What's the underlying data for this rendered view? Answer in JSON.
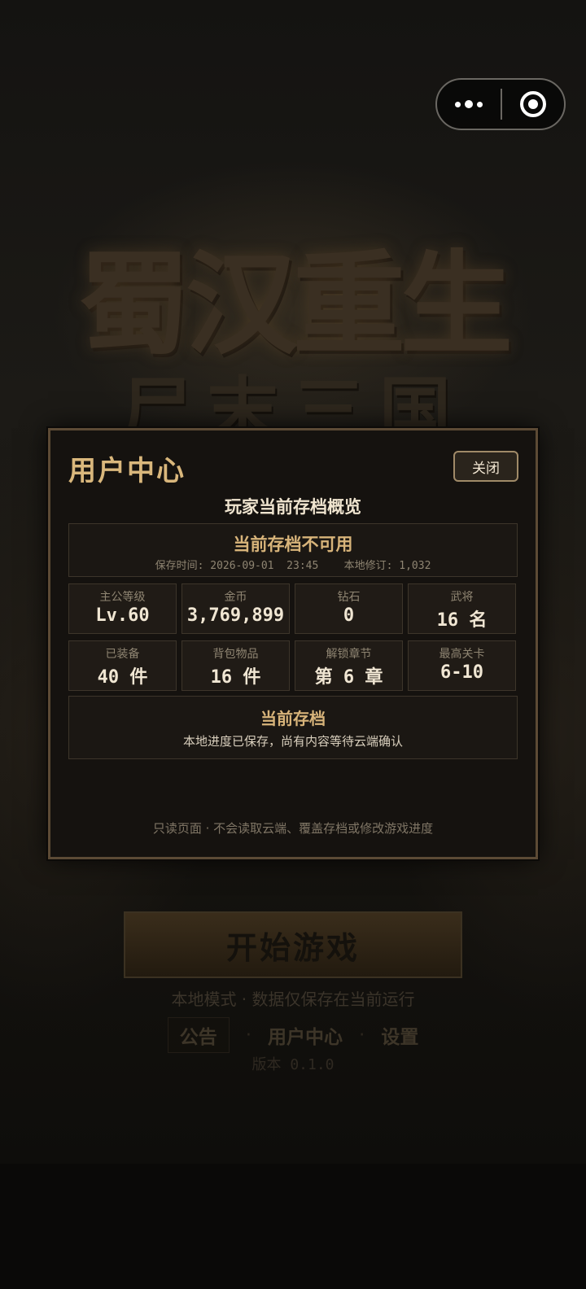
{
  "background": {
    "logo_main": "蜀汉重生",
    "logo_sub": "尸末三国"
  },
  "capsule": {
    "more_icon": "more-dots-icon",
    "close_icon": "target-close-icon"
  },
  "home": {
    "start_label": "开始游戏",
    "mode_note": "本地模式 · 数据仅保存在当前运行",
    "links": [
      "公告",
      "用户中心",
      "设置"
    ],
    "separator": "·",
    "version": "版本 0.1.0"
  },
  "modal": {
    "title": "用户中心",
    "close_label": "关闭",
    "subtitle": "玩家当前存档概览",
    "status": {
      "title": "当前存档不可用",
      "meta": "保存时间: 2026-09-01  23:45    本地修订: 1,032"
    },
    "stats": [
      {
        "label": "主公等级",
        "value": "Lv.60"
      },
      {
        "label": "金币",
        "value": "3,769,899"
      },
      {
        "label": "钻石",
        "value": "0"
      },
      {
        "label": "武将",
        "value": "16 名"
      },
      {
        "label": "已装备",
        "value": "40 件"
      },
      {
        "label": "背包物品",
        "value": "16 件"
      },
      {
        "label": "解锁章节",
        "value": "第 6 章"
      },
      {
        "label": "最高关卡",
        "value": "6-10"
      }
    ],
    "save": {
      "title": "当前存档",
      "desc": "本地进度已保存，尚有内容等待云端确认"
    },
    "footer": "只读页面 · 不会读取云端、覆盖存档或修改游戏进度"
  },
  "colors": {
    "accent_gold": "#d8b47a",
    "panel_bg": "#15120f",
    "panel_border": "#5c4a35"
  }
}
